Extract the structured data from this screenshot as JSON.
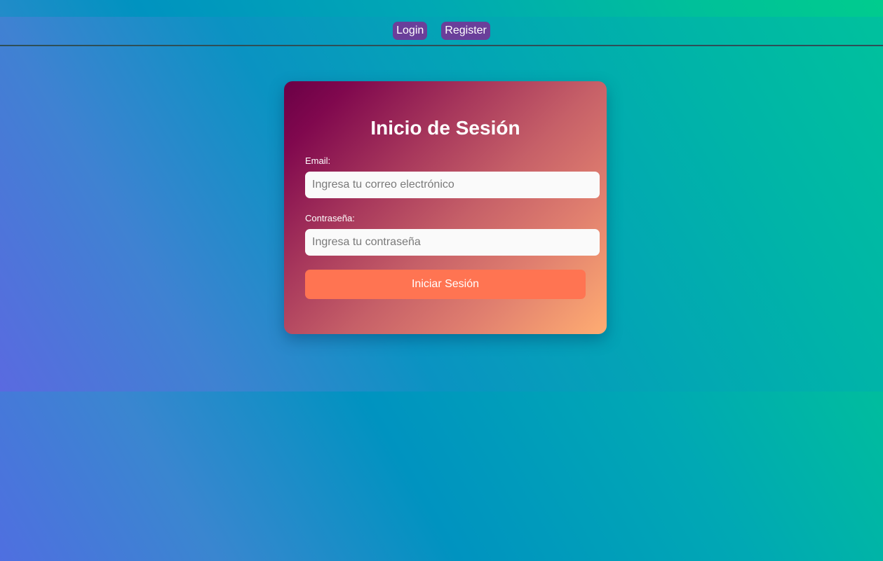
{
  "nav": {
    "login_label": "Login",
    "register_label": "Register"
  },
  "login_form": {
    "title": "Inicio de Sesión",
    "email_label": "Email:",
    "email_placeholder": "Ingresa tu correo electrónico",
    "email_value": "",
    "password_label": "Contraseña:",
    "password_placeholder": "Ingresa tu contraseña",
    "password_value": "",
    "submit_label": "Iniciar Sesión"
  },
  "colors": {
    "nav_button": "#6a3f9a",
    "submit_button": "#ff7452",
    "card_gradient_start": "#6a0046",
    "card_gradient_end": "#ffad72",
    "page_gradient_start": "#4f6fe0",
    "page_gradient_end": "#00cc8e"
  }
}
